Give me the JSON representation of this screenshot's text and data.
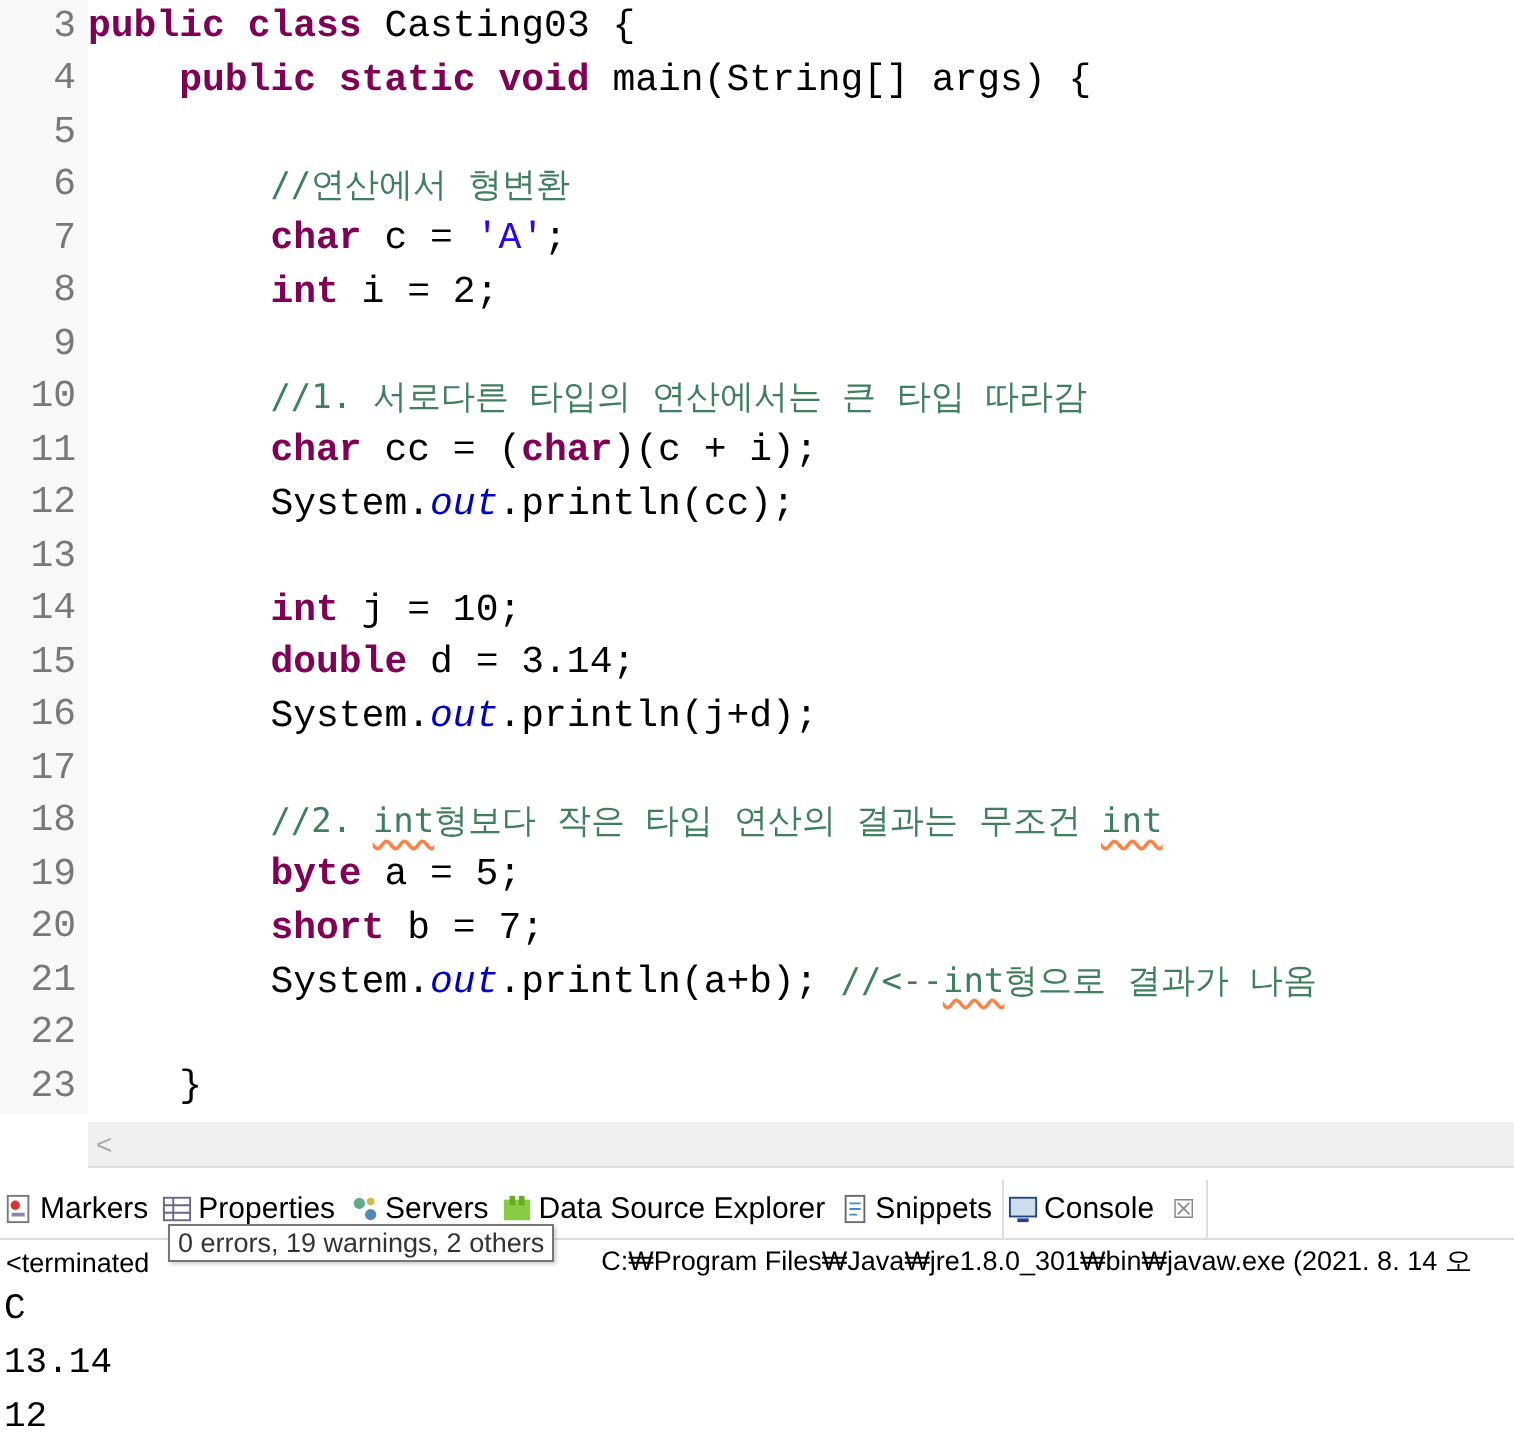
{
  "editor": {
    "lines": [
      {
        "number": "3",
        "kind": "class",
        "tokens": [
          {
            "kind": "keyword",
            "text": "public class"
          },
          {
            "kind": "plain",
            "text": " Casting03 {"
          }
        ]
      },
      {
        "number": "4",
        "kind": "member",
        "tokens": [
          {
            "kind": "keyword",
            "text": "public static void"
          },
          {
            "kind": "plain",
            "text": " main(String[] args) {"
          }
        ]
      },
      {
        "number": "5",
        "kind": "blank"
      },
      {
        "number": "6",
        "kind": "body",
        "tokens": [
          {
            "kind": "comment",
            "text": "//연산에서 형변환"
          }
        ]
      },
      {
        "number": "7",
        "kind": "body",
        "tokens": [
          {
            "kind": "keyword",
            "text": "char"
          },
          {
            "kind": "plain",
            "text": " c = "
          },
          {
            "kind": "string",
            "text": "'A'"
          },
          {
            "kind": "plain",
            "text": ";"
          }
        ]
      },
      {
        "number": "8",
        "kind": "body",
        "tokens": [
          {
            "kind": "keyword",
            "text": "int"
          },
          {
            "kind": "plain",
            "text": " i = 2;"
          }
        ]
      },
      {
        "number": "9",
        "kind": "blank"
      },
      {
        "number": "10",
        "kind": "body",
        "tokens": [
          {
            "kind": "comment",
            "text": "//1. 서로다른 타입의 연산에서는 큰 타입 따라감"
          }
        ]
      },
      {
        "number": "11",
        "kind": "body",
        "tokens": [
          {
            "kind": "keyword",
            "text": "char"
          },
          {
            "kind": "plain",
            "text": " cc = ("
          },
          {
            "kind": "keyword",
            "text": "char"
          },
          {
            "kind": "plain",
            "text": ")(c + i);"
          }
        ]
      },
      {
        "number": "12",
        "kind": "body",
        "tokens": [
          {
            "kind": "plain",
            "text": "System."
          },
          {
            "kind": "field",
            "text": "out"
          },
          {
            "kind": "plain",
            "text": ".println(cc);"
          }
        ]
      },
      {
        "number": "13",
        "kind": "blank"
      },
      {
        "number": "14",
        "kind": "body",
        "tokens": [
          {
            "kind": "keyword",
            "text": "int"
          },
          {
            "kind": "plain",
            "text": " j = 10;"
          }
        ]
      },
      {
        "number": "15",
        "kind": "body",
        "tokens": [
          {
            "kind": "keyword",
            "text": "double"
          },
          {
            "kind": "plain",
            "text": " d = 3.14;"
          }
        ]
      },
      {
        "number": "16",
        "kind": "body",
        "tokens": [
          {
            "kind": "plain",
            "text": "System."
          },
          {
            "kind": "field",
            "text": "out"
          },
          {
            "kind": "plain",
            "text": ".println(j+d);"
          }
        ]
      },
      {
        "number": "17",
        "kind": "blank"
      },
      {
        "number": "18",
        "kind": "body",
        "tokens": [
          {
            "kind": "comment",
            "text": "//2. "
          },
          {
            "kind": "flagged",
            "text": "int"
          },
          {
            "kind": "comment",
            "text": "형보다 작은 타입 연산의 결과는 무조건 "
          },
          {
            "kind": "flagged",
            "text": "int"
          }
        ]
      },
      {
        "number": "19",
        "kind": "body",
        "tokens": [
          {
            "kind": "keyword",
            "text": "byte"
          },
          {
            "kind": "plain",
            "text": " a = 5;"
          }
        ]
      },
      {
        "number": "20",
        "kind": "body",
        "tokens": [
          {
            "kind": "keyword",
            "text": "short"
          },
          {
            "kind": "plain",
            "text": " b = 7;"
          }
        ]
      },
      {
        "number": "21",
        "kind": "body",
        "tokens": [
          {
            "kind": "plain",
            "text": "System."
          },
          {
            "kind": "field",
            "text": "out"
          },
          {
            "kind": "plain",
            "text": ".println(a+b); "
          },
          {
            "kind": "comment",
            "text": "//<--"
          },
          {
            "kind": "flagged",
            "text": "int"
          },
          {
            "kind": "comment",
            "text": "형으로 결과가 나옴"
          }
        ]
      },
      {
        "number": "22",
        "kind": "blank"
      },
      {
        "number": "23",
        "kind": "member",
        "tokens": [
          {
            "kind": "plain",
            "text": "}"
          }
        ]
      }
    ],
    "scroll_arrow": "<"
  },
  "views": {
    "tabs": [
      {
        "label": "Markers",
        "selected": false
      },
      {
        "label": "Properties",
        "selected": false
      },
      {
        "label": "Servers",
        "selected": false
      },
      {
        "label": "Data Source Explorer",
        "selected": false
      },
      {
        "label": "Snippets",
        "selected": false
      },
      {
        "label": "Console",
        "selected": true,
        "close": "☒"
      }
    ],
    "tooltip": "0 errors, 19 warnings, 2 others"
  },
  "console": {
    "status_start": "<terminated",
    "status_end": "C:₩Program Files₩Java₩jre1.8.0_301₩bin₩javaw.exe  (2021. 8. 14 오",
    "output": [
      "C",
      "13.14",
      "12"
    ]
  }
}
